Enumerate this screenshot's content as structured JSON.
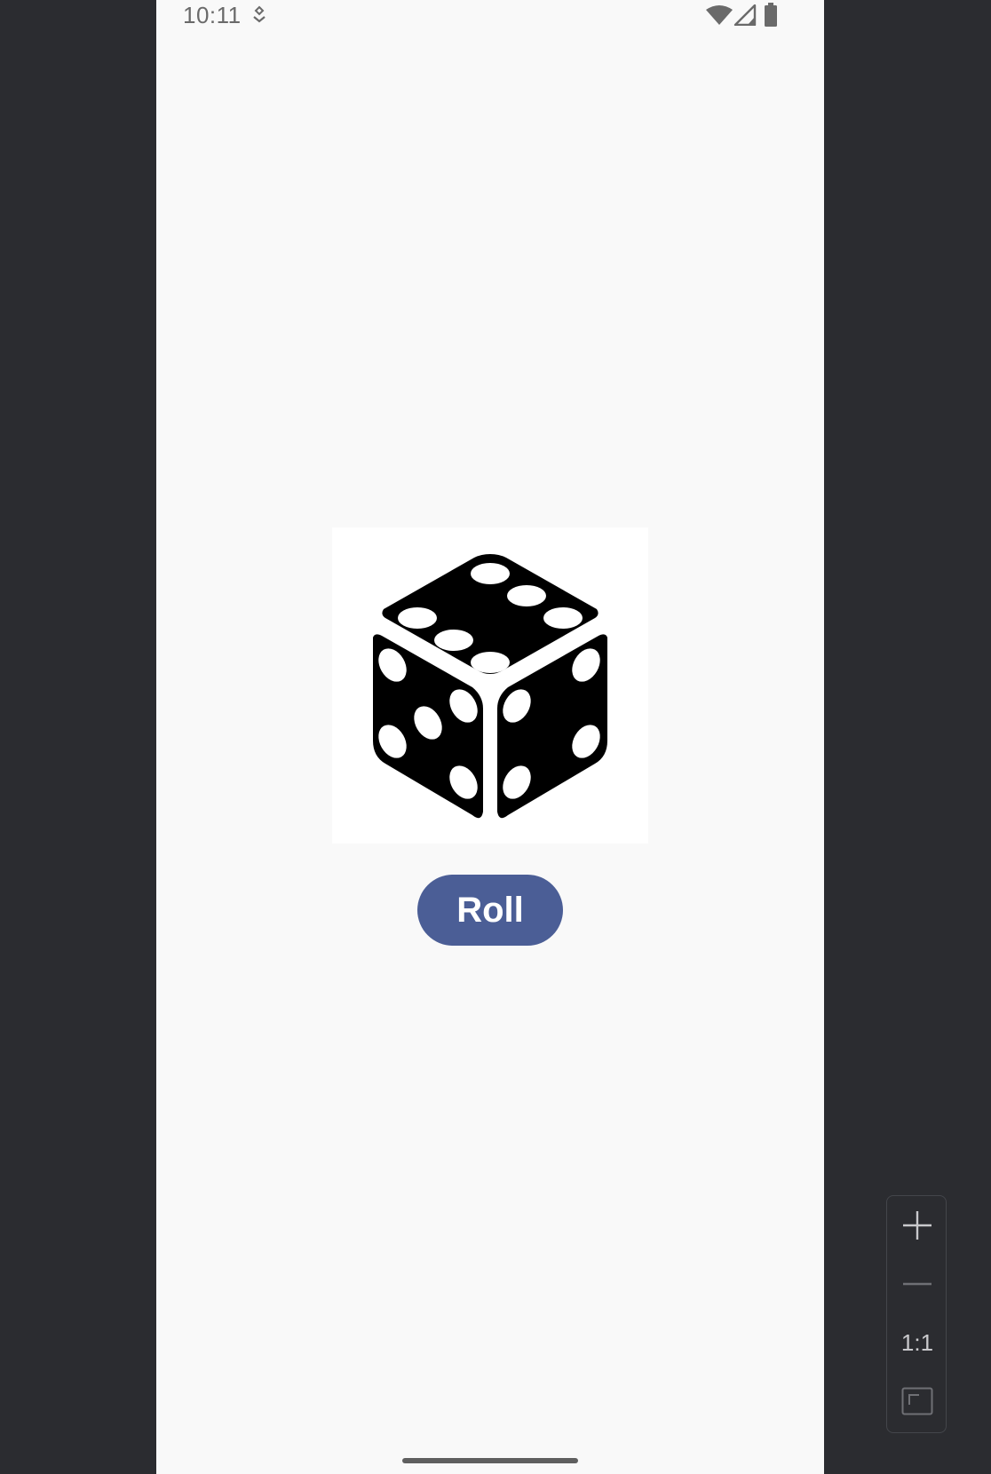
{
  "status_bar": {
    "time": "10:11",
    "icons": [
      "notification-icon",
      "wifi-icon",
      "cellular-signal-icon",
      "battery-icon"
    ]
  },
  "app": {
    "dice_image": {
      "icon": "dice-six-icon",
      "top_face_value": 6,
      "left_face_value": 5,
      "right_face_value": 4
    },
    "roll_button_label": "Roll"
  },
  "emulator_controls": {
    "zoom_in_icon": "plus-icon",
    "zoom_out_icon": "minus-icon",
    "zoom_reset_label": "1:1",
    "fit_screen_icon": "fit-screen-icon"
  },
  "colors": {
    "button": "#4b5e96",
    "screen_background": "#f9f9f9",
    "emulator_background": "#2b2c30"
  }
}
